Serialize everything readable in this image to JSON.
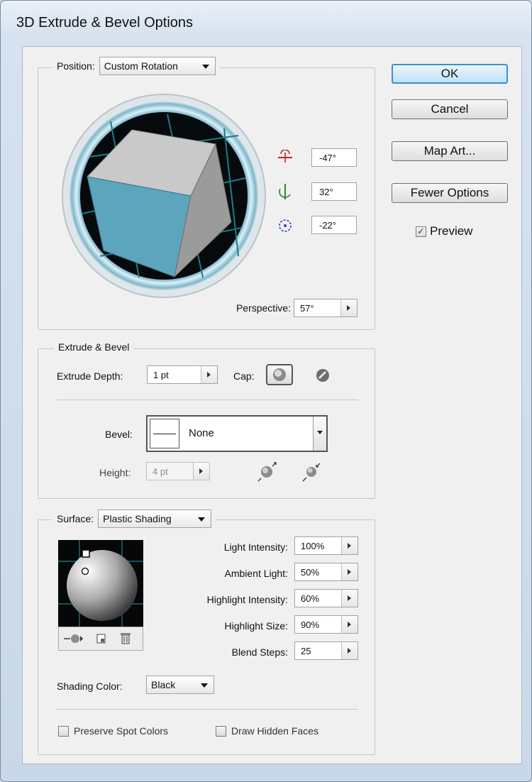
{
  "window": {
    "title": "3D Extrude & Bevel Options"
  },
  "buttons": {
    "ok": "OK",
    "cancel": "Cancel",
    "map_art": "Map Art...",
    "fewer_options": "Fewer Options"
  },
  "preview": {
    "label": "Preview",
    "checked": true
  },
  "position": {
    "label": "Position:",
    "value": "Custom Rotation",
    "rot_x": "-47°",
    "rot_y": "32°",
    "rot_z": "-22°",
    "perspective_label": "Perspective:",
    "perspective": "57°"
  },
  "extrude": {
    "group_label": "Extrude & Bevel",
    "depth_label": "Extrude Depth:",
    "depth": "1 pt",
    "cap_label": "Cap:",
    "bevel_label": "Bevel:",
    "bevel": "None",
    "height_label": "Height:",
    "height": "4 pt"
  },
  "surface": {
    "label": "Surface:",
    "value": "Plastic Shading",
    "params": [
      {
        "label": "Light Intensity:",
        "value": "100%"
      },
      {
        "label": "Ambient Light:",
        "value": "50%"
      },
      {
        "label": "Highlight Intensity:",
        "value": "60%"
      },
      {
        "label": "Highlight Size:",
        "value": "90%"
      },
      {
        "label": "Blend Steps:",
        "value": "25"
      }
    ],
    "shading_color_label": "Shading Color:",
    "shading_color": "Black",
    "preserve_spot": "Preserve Spot Colors",
    "draw_hidden": "Draw Hidden Faces"
  },
  "icons": {
    "rot_x": "x-axis-rotation-icon",
    "rot_y": "y-axis-rotation-icon",
    "rot_z": "z-axis-rotation-icon",
    "cap_on": "cap-on-icon",
    "cap_off": "cap-off-icon",
    "bevel_out": "bevel-extent-out-icon",
    "bevel_in": "bevel-extent-in-icon",
    "move_light_back": "move-light-back-icon",
    "new_light": "new-light-icon",
    "delete_light": "delete-light-icon"
  }
}
